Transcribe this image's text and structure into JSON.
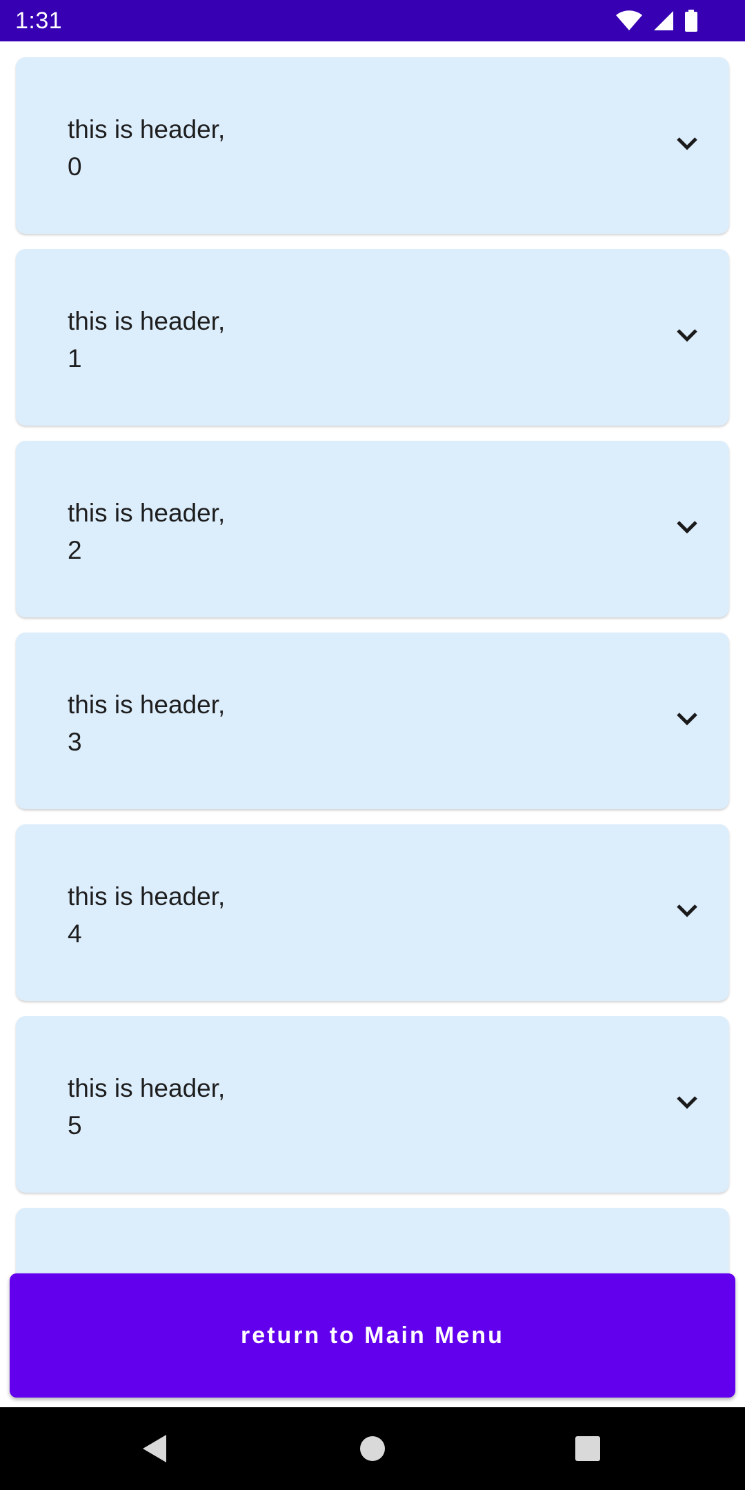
{
  "status_bar": {
    "time": "1:31",
    "icons": [
      "wifi-icon",
      "cellular-signal-icon",
      "battery-icon"
    ],
    "background": "#3700b3"
  },
  "list": {
    "items": [
      {
        "label": "this is header,",
        "index": "0"
      },
      {
        "label": "this is header,",
        "index": "1"
      },
      {
        "label": "this is header,",
        "index": "2"
      },
      {
        "label": "this is header,",
        "index": "3"
      },
      {
        "label": "this is header,",
        "index": "4"
      },
      {
        "label": "this is header,",
        "index": "5"
      },
      {
        "label": "",
        "index": ""
      }
    ],
    "item_icon": "chevron-down-icon",
    "card_color": "#dcedfc"
  },
  "return_button": {
    "label": "return to Main Menu",
    "color": "#6200ee"
  },
  "nav_bar": {
    "buttons": [
      "back-icon",
      "home-icon",
      "recents-icon"
    ]
  }
}
